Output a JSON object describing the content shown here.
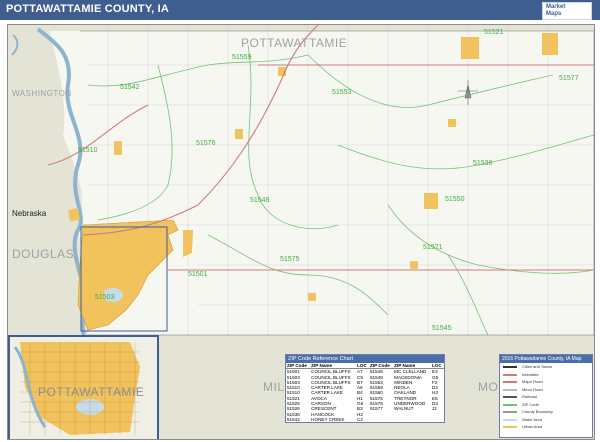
{
  "title": "POTTAWATTAMIE COUNTY, IA",
  "logo": {
    "line1": "Market",
    "line2": "Maps"
  },
  "map_labels": {
    "county": "POTTAWATTAMIE",
    "washington": "WASHINGTON",
    "nebraska": "Nebraska",
    "douglas": "DOUGLAS",
    "mills": "MILL",
    "montgomery": "MO",
    "inset_county": "POTTAWATTAMIE"
  },
  "zip_labels": [
    "51559",
    "51521",
    "51577",
    "51542",
    "51553",
    "51576",
    "51536",
    "51548",
    "51550",
    "51575",
    "51501",
    "51503",
    "51510",
    "51545",
    "51521"
  ],
  "colors": {
    "water": "#c7dbe9",
    "land": "#f7f7f2",
    "urban": "#f2c25c",
    "zip_line": "#74c274",
    "road": "#d07a7a",
    "outside": "#e3e3d6",
    "title_bg": "#3f5e8f"
  },
  "zip_table": {
    "header": "ZIP Code Reference Chart",
    "columns": [
      "ZIP Code",
      "ZIP Name",
      "LOC",
      "ZIP Code",
      "ZIP Name",
      "LOC"
    ],
    "rows": [
      [
        "51501",
        "COUNCIL BLUFFS",
        "A7",
        "51548",
        "MC CLELLAND",
        "E3"
      ],
      [
        "51503",
        "COUNCIL BLUFFS",
        "C5",
        "51549",
        "MACEDONIA",
        "G5"
      ],
      [
        "51503",
        "COUNCIL BLUFFS",
        "B7",
        "51553",
        "MINDEN",
        "F2"
      ],
      [
        "51510",
        "CARTER LAKE",
        "A6",
        "51559",
        "NEOLA",
        "D2"
      ],
      [
        "51510",
        "CARTER LAKE",
        "B4",
        "51560",
        "OAKLAND",
        "H3"
      ],
      [
        "51521",
        "AVOCA",
        "H1",
        "51575",
        "TREYNOR",
        "E5"
      ],
      [
        "51525",
        "CARSON",
        "G5",
        "51576",
        "UNDERWOOD",
        "D3"
      ],
      [
        "51526",
        "CRESCENT",
        "B3",
        "51577",
        "WALNUT",
        "J2"
      ],
      [
        "51536",
        "HANCOCK",
        "H2",
        "",
        "",
        ""
      ],
      [
        "51542",
        "HONEY CREEK",
        "C2",
        "",
        "",
        ""
      ]
    ]
  },
  "legend": {
    "header": "2016 Pottawattamie County, IA Map",
    "items": [
      "Cities and Towns",
      "Interstate",
      "Major Road",
      "Minor Road",
      "Railroad",
      "ZIP Code",
      "County Boundary",
      "Water Area",
      "Urban Area"
    ]
  }
}
